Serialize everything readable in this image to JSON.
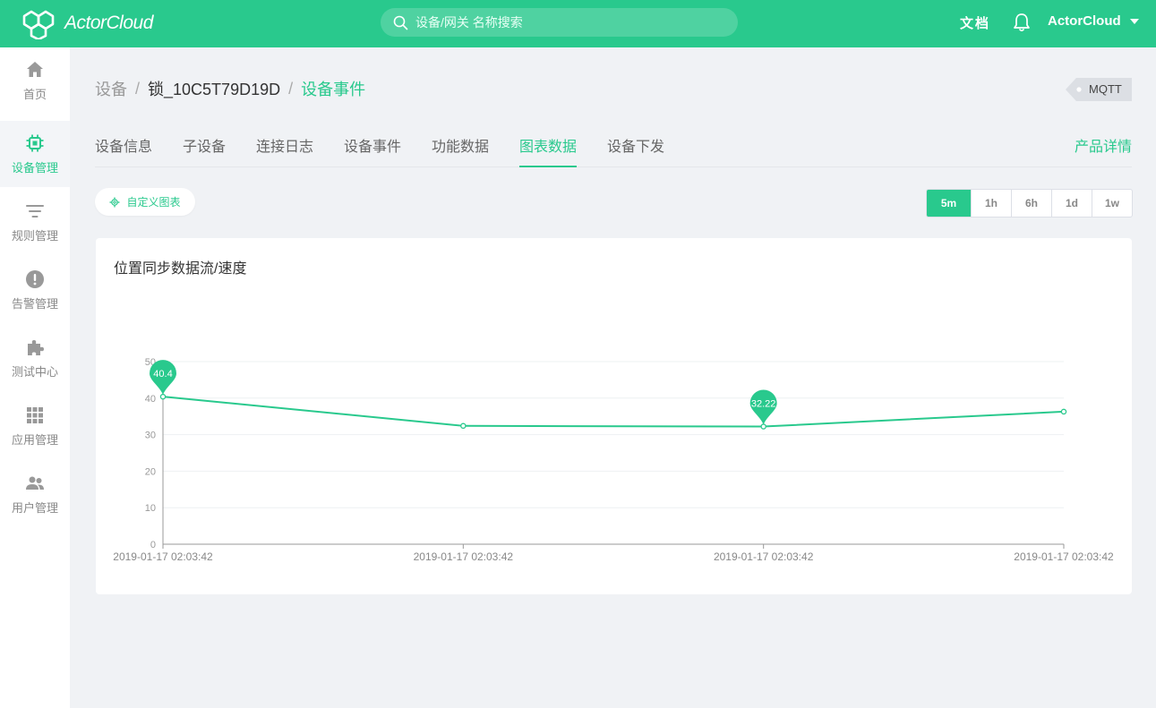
{
  "header": {
    "logo_text": "ActorCloud",
    "search_placeholder": "设备/网关 名称搜索",
    "docs_label": "文档",
    "user_name": "ActorCloud"
  },
  "sidebar": {
    "items": [
      {
        "label": "首页",
        "icon": "home-icon"
      },
      {
        "label": "设备管理",
        "icon": "chip-icon"
      },
      {
        "label": "规则管理",
        "icon": "filter-icon"
      },
      {
        "label": "告警管理",
        "icon": "alert-icon"
      },
      {
        "label": "测试中心",
        "icon": "puzzle-icon"
      },
      {
        "label": "应用管理",
        "icon": "grid-icon"
      },
      {
        "label": "用户管理",
        "icon": "users-icon"
      }
    ],
    "active_index": 1
  },
  "breadcrumb": {
    "root": "设备",
    "device": "锁_10C5T79D19D",
    "current": "设备事件"
  },
  "protocol_tag": "MQTT",
  "tabs": [
    {
      "label": "设备信息"
    },
    {
      "label": "子设备"
    },
    {
      "label": "连接日志"
    },
    {
      "label": "设备事件"
    },
    {
      "label": "功能数据"
    },
    {
      "label": "图表数据"
    },
    {
      "label": "设备下发"
    }
  ],
  "active_tab": "图表数据",
  "product_link": "产品详情",
  "custom_chart_label": "自定义图表",
  "time_ranges": [
    "5m",
    "1h",
    "6h",
    "1d",
    "1w"
  ],
  "active_range": "5m",
  "colors": {
    "accent": "#29c98d"
  },
  "chart_data": {
    "type": "line",
    "title": "位置同步数据流/速度",
    "categories": [
      "2019-01-17 02:03:42",
      "2019-01-17 02:03:42",
      "2019-01-17 02:03:42",
      "2019-01-17 02:03:42"
    ],
    "series": [
      {
        "values": [
          40.4,
          32.4,
          32.22,
          36.3
        ]
      }
    ],
    "markers": [
      {
        "label": "40.4",
        "index": 0
      },
      {
        "label": "32.22",
        "index": 2
      }
    ],
    "ylim": [
      0,
      50
    ],
    "yticks": [
      0,
      10,
      20,
      30,
      40,
      50
    ],
    "grid": true
  }
}
